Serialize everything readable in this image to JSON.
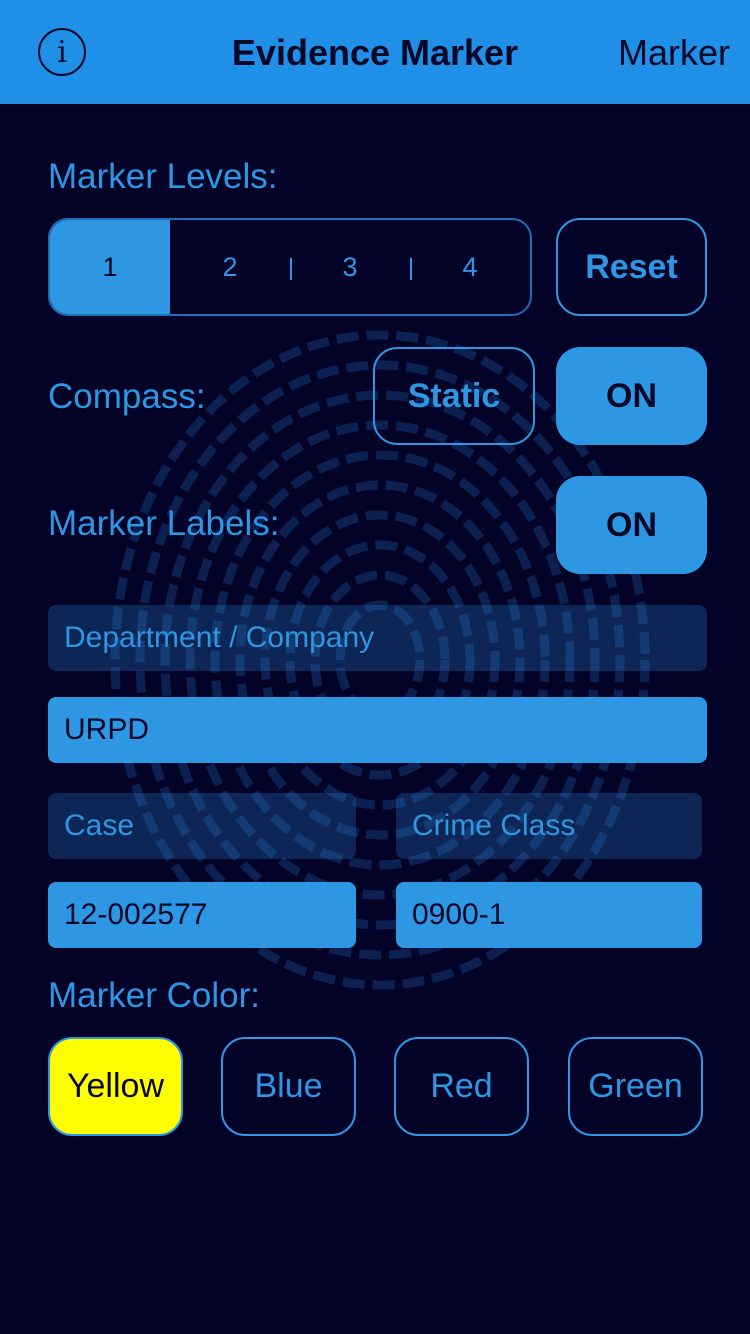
{
  "navbar": {
    "info_glyph": "i",
    "title": "Evidence Marker",
    "right_label": "Marker"
  },
  "marker_levels": {
    "label": "Marker Levels:",
    "segments": [
      "1",
      "2",
      "3",
      "4"
    ],
    "selected": "1",
    "reset_label": "Reset"
  },
  "compass": {
    "label": "Compass:",
    "mode_label": "Static",
    "toggle_label": "ON"
  },
  "marker_labels": {
    "label": "Marker Labels:",
    "toggle_label": "ON"
  },
  "fields": {
    "department_placeholder": "Department / Company",
    "department_value": "URPD",
    "case_placeholder": "Case",
    "case_value": "12-002577",
    "crime_class_placeholder": "Crime Class",
    "crime_class_value": "0900-1"
  },
  "marker_color": {
    "label": "Marker Color:",
    "options": [
      "Yellow",
      "Blue",
      "Red",
      "Green"
    ],
    "selected": "Yellow"
  },
  "colors": {
    "accent": "#2e97e4",
    "navbar": "#1f8fe8",
    "background": "#020326",
    "selected_color": "#ffff00"
  },
  "icons": {
    "info": "info-icon",
    "background": "fingerprint-icon"
  }
}
